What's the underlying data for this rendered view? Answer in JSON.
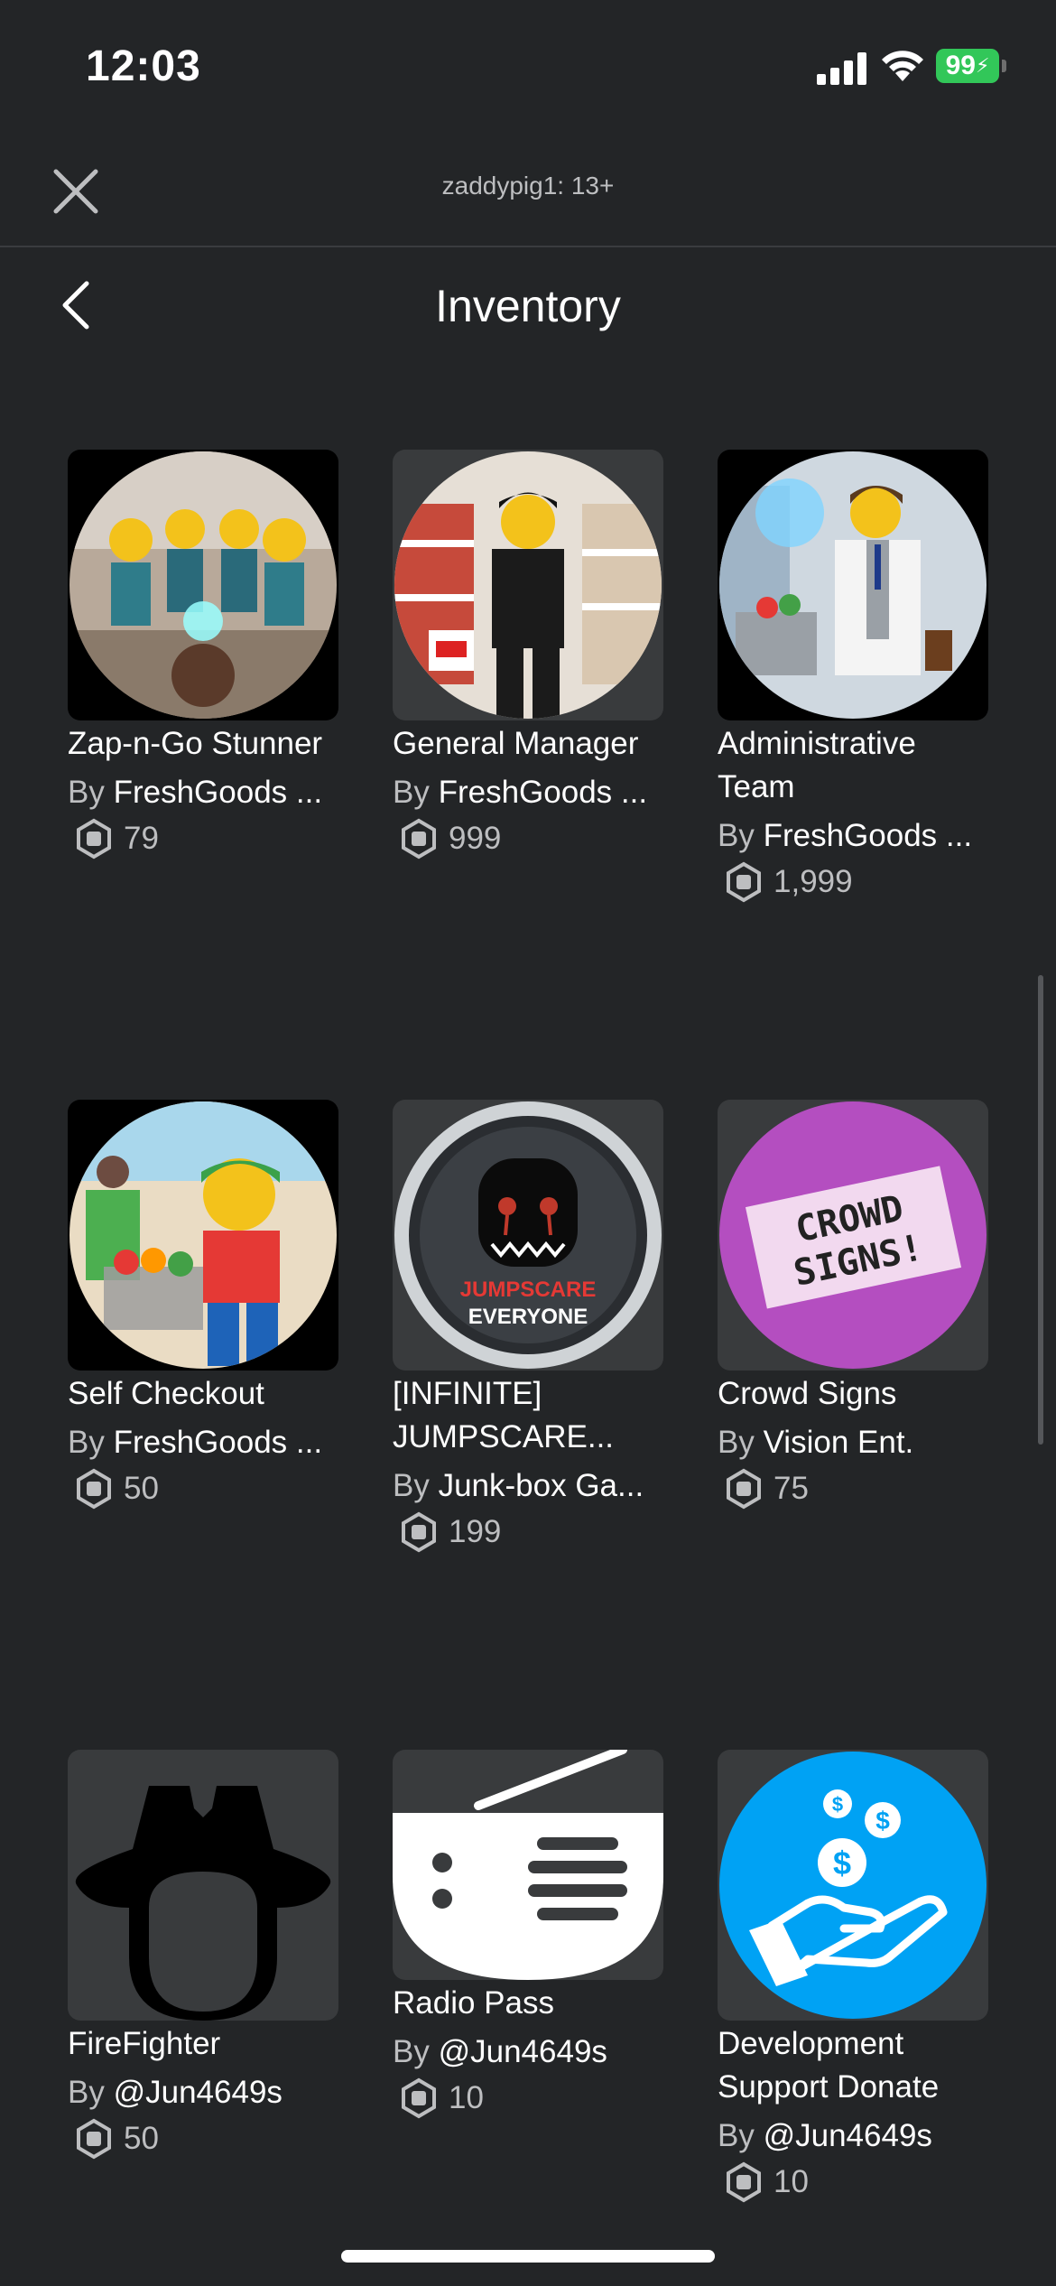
{
  "status_bar": {
    "time": "12:03",
    "battery": "99"
  },
  "top_nav": {
    "account_label": "zaddypig1: 13+"
  },
  "header": {
    "title": "Inventory"
  },
  "currency_prefix": "By",
  "items": [
    {
      "name": "Zap-n-Go Stunner",
      "by": "By",
      "creator": "FreshGoods ...",
      "price": "79",
      "icon": "police-stun-thumbnail"
    },
    {
      "name": "General Manager",
      "by": "By",
      "creator": "FreshGoods ...",
      "price": "999",
      "icon": "manager-thumbnail"
    },
    {
      "name": "Administrative Team",
      "by": "By",
      "creator": "FreshGoods ...",
      "price": "1,999",
      "icon": "admin-thumbnail"
    },
    {
      "name": "Self Checkout",
      "by": "By",
      "creator": "FreshGoods ...",
      "price": "50",
      "icon": "checkout-thumbnail"
    },
    {
      "name": "[INFINITE] JUMPSCARE...",
      "by": "By",
      "creator": "Junk-box Ga...",
      "price": "199",
      "icon": "jumpscare-thumbnail",
      "thumb_text1": "JUMPSCARE",
      "thumb_text2": "EVERYONE"
    },
    {
      "name": "Crowd Signs",
      "by": "By",
      "creator": "Vision Ent.",
      "price": "75",
      "icon": "crowd-signs-thumbnail",
      "thumb_text1": "CROWD",
      "thumb_text2": "SIGNS!"
    },
    {
      "name": "FireFighter",
      "by": "By",
      "creator": "@Jun4649s",
      "price": "50",
      "icon": "firefighter-helmet-icon"
    },
    {
      "name": "Radio Pass",
      "by": "By",
      "creator": "@Jun4649s",
      "price": "10",
      "icon": "radio-icon"
    },
    {
      "name": "Development Support Donate",
      "by": "By",
      "creator": "@Jun4649s",
      "price": "10",
      "icon": "donate-hand-icon"
    }
  ],
  "colors": {
    "background": "#232527",
    "tile": "#393b3d",
    "secondary_text": "#bdbec0",
    "battery": "#32c759",
    "donate_blue": "#00a2f4",
    "crowd_purple": "#b44ec0"
  }
}
